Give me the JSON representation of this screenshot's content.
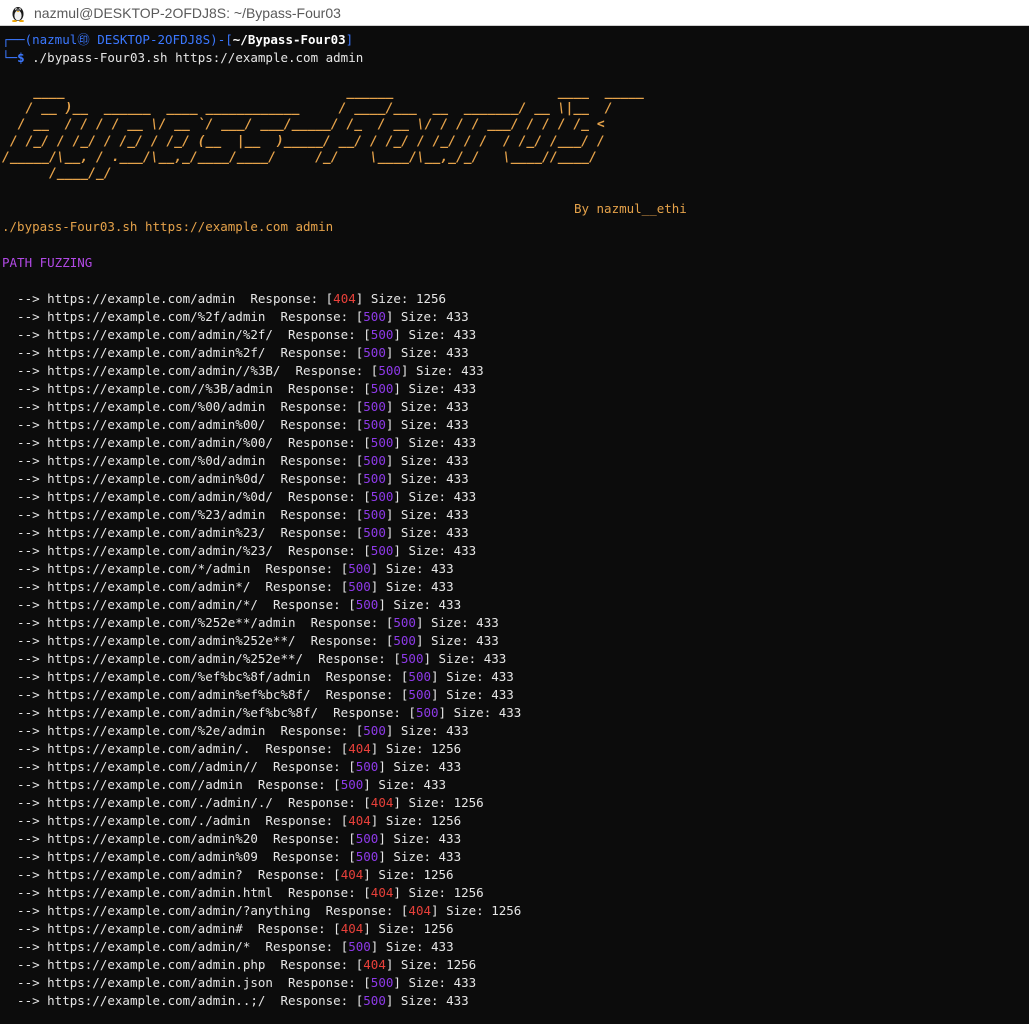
{
  "window": {
    "title": "nazmul@DESKTOP-2OFDJ8S: ~/Bypass-Four03",
    "icon": "tux-icon"
  },
  "prompt": {
    "user_host": "(nazmul㊞ DESKTOP-2OFDJ8S)",
    "path": "~/Bypass-Four03",
    "command": "./bypass-Four03.sh https://example.com admin"
  },
  "banner": {
    "art": "    ____                                    ______                     ____  _____\n   / __ )__  ______  ____ ____________     / ____/___  __  _______/ __ \\|__  /\n  / __  / / / / __ \\/ __ `/ ___/ ___/_____/ /_  / __ \\/ / / / ___/ / / / /_ <\n / /_/ / /_/ / /_/ / /_/ (__  |__  )_____/ __/ / /_/ / /_/ / /  / /_/ /___/ /\n/_____/\\__, / .___/\\__,_/____/____/     /_/    \\____/\\__,_/_/   \\____//____/\n      /____/_/",
    "author": "By nazmul__ethi"
  },
  "echo_command": "./bypass-Four03.sh https://example.com admin",
  "section_title": "PATH FUZZING",
  "labels": {
    "arrow": "  --> ",
    "response": "Response: ",
    "size": "Size: "
  },
  "results": [
    {
      "url": "https://example.com/admin",
      "code": "404",
      "size": "1256"
    },
    {
      "url": "https://example.com/%2f/admin",
      "code": "500",
      "size": "433"
    },
    {
      "url": "https://example.com/admin/%2f/",
      "code": "500",
      "size": "433"
    },
    {
      "url": "https://example.com/admin%2f/",
      "code": "500",
      "size": "433"
    },
    {
      "url": "https://example.com/admin//%3B/",
      "code": "500",
      "size": "433"
    },
    {
      "url": "https://example.com//%3B/admin",
      "code": "500",
      "size": "433"
    },
    {
      "url": "https://example.com/%00/admin",
      "code": "500",
      "size": "433"
    },
    {
      "url": "https://example.com/admin%00/",
      "code": "500",
      "size": "433"
    },
    {
      "url": "https://example.com/admin/%00/",
      "code": "500",
      "size": "433"
    },
    {
      "url": "https://example.com/%0d/admin",
      "code": "500",
      "size": "433"
    },
    {
      "url": "https://example.com/admin%0d/",
      "code": "500",
      "size": "433"
    },
    {
      "url": "https://example.com/admin/%0d/",
      "code": "500",
      "size": "433"
    },
    {
      "url": "https://example.com/%23/admin",
      "code": "500",
      "size": "433"
    },
    {
      "url": "https://example.com/admin%23/",
      "code": "500",
      "size": "433"
    },
    {
      "url": "https://example.com/admin/%23/",
      "code": "500",
      "size": "433"
    },
    {
      "url": "https://example.com/*/admin",
      "code": "500",
      "size": "433"
    },
    {
      "url": "https://example.com/admin*/",
      "code": "500",
      "size": "433"
    },
    {
      "url": "https://example.com/admin/*/",
      "code": "500",
      "size": "433"
    },
    {
      "url": "https://example.com/%252e**/admin",
      "code": "500",
      "size": "433"
    },
    {
      "url": "https://example.com/admin%252e**/",
      "code": "500",
      "size": "433"
    },
    {
      "url": "https://example.com/admin/%252e**/",
      "code": "500",
      "size": "433"
    },
    {
      "url": "https://example.com/%ef%bc%8f/admin",
      "code": "500",
      "size": "433"
    },
    {
      "url": "https://example.com/admin%ef%bc%8f/",
      "code": "500",
      "size": "433"
    },
    {
      "url": "https://example.com/admin/%ef%bc%8f/",
      "code": "500",
      "size": "433"
    },
    {
      "url": "https://example.com/%2e/admin",
      "code": "500",
      "size": "433"
    },
    {
      "url": "https://example.com/admin/.",
      "code": "404",
      "size": "1256"
    },
    {
      "url": "https://example.com//admin//",
      "code": "500",
      "size": "433"
    },
    {
      "url": "https://example.com//admin",
      "code": "500",
      "size": "433"
    },
    {
      "url": "https://example.com/./admin/./",
      "code": "404",
      "size": "1256"
    },
    {
      "url": "https://example.com/./admin",
      "code": "404",
      "size": "1256"
    },
    {
      "url": "https://example.com/admin%20",
      "code": "500",
      "size": "433"
    },
    {
      "url": "https://example.com/admin%09",
      "code": "500",
      "size": "433"
    },
    {
      "url": "https://example.com/admin?",
      "code": "404",
      "size": "1256"
    },
    {
      "url": "https://example.com/admin.html",
      "code": "404",
      "size": "1256"
    },
    {
      "url": "https://example.com/admin/?anything",
      "code": "404",
      "size": "1256"
    },
    {
      "url": "https://example.com/admin#",
      "code": "404",
      "size": "1256"
    },
    {
      "url": "https://example.com/admin/*",
      "code": "500",
      "size": "433"
    },
    {
      "url": "https://example.com/admin.php",
      "code": "404",
      "size": "1256"
    },
    {
      "url": "https://example.com/admin.json",
      "code": "500",
      "size": "433"
    },
    {
      "url": "https://example.com/admin..;/",
      "code": "500",
      "size": "433"
    }
  ],
  "colors": {
    "background": "#0c0c0c",
    "prompt": "#3b78ff",
    "banner": "#e5a24a",
    "section": "#b149e5",
    "code_404": "#e8403a",
    "code_500": "#8e3ae8"
  }
}
